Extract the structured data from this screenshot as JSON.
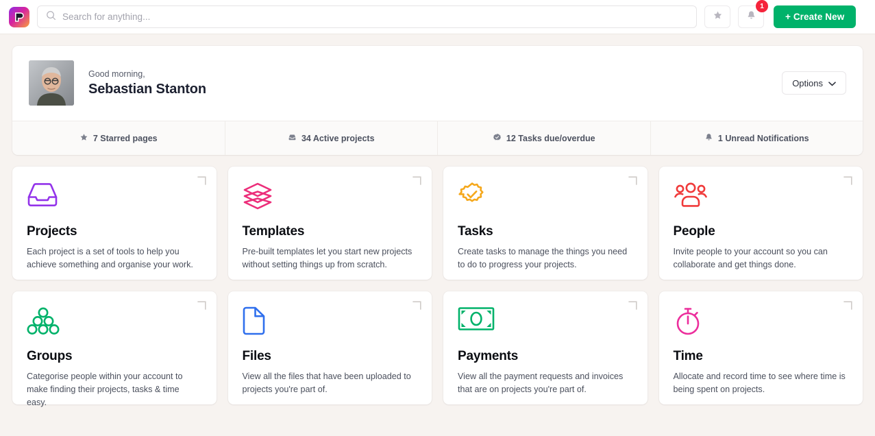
{
  "topbar": {
    "logo_icon": "flow-p-logo-icon",
    "search": {
      "icon": "search-icon",
      "placeholder": "Search for anything...",
      "value": ""
    },
    "star_button_icon": "star-icon",
    "notifications_button_icon": "bell-icon",
    "notifications_badge": "1",
    "create_label": "+ Create New"
  },
  "greeting": {
    "avatar_alt": "avatar",
    "salutation": "Good morning,",
    "name": "Sebastian Stanton",
    "options_label": "Options",
    "options_chevron_icon": "chevron-down-icon"
  },
  "stats": [
    {
      "icon": "star-icon",
      "label": "7 Starred pages"
    },
    {
      "icon": "inbox-icon",
      "label": "34 Active projects"
    },
    {
      "icon": "badge-check-icon",
      "label": "12 Tasks due/overdue"
    },
    {
      "icon": "bell-icon",
      "label": "1 Unread Notifications"
    }
  ],
  "tiles": [
    {
      "icon": "inbox-tray-icon",
      "color": "#9333ea",
      "title": "Projects",
      "desc": "Each project is a set of tools to help you achieve something and organise your work.",
      "corner_icon": "corner-expand-icon"
    },
    {
      "icon": "layers-icon",
      "color": "#ec2e7a",
      "title": "Templates",
      "desc": "Pre-built templates let you start new projects without setting things up from scratch.",
      "corner_icon": "corner-expand-icon"
    },
    {
      "icon": "badge-check-icon",
      "color": "#f5a81c",
      "title": "Tasks",
      "desc": "Create tasks to manage the things you need to do to progress your projects.",
      "corner_icon": "corner-expand-icon"
    },
    {
      "icon": "people-group-icon",
      "color": "#f03a3a",
      "title": "People",
      "desc": "Invite people to your account so you can collaborate and get things done.",
      "corner_icon": "corner-expand-icon"
    },
    {
      "icon": "circles-pyramid-icon",
      "color": "#00b26a",
      "title": "Groups",
      "desc": "Categorise people within your account to make finding their projects, tasks & time easy.",
      "corner_icon": "corner-expand-icon"
    },
    {
      "icon": "document-icon",
      "color": "#2f6fed",
      "title": "Files",
      "desc": "View all the files that have been uploaded to projects you're part of.",
      "corner_icon": "corner-expand-icon"
    },
    {
      "icon": "banknote-icon",
      "color": "#00b26a",
      "title": "Payments",
      "desc": "View all the payment requests and invoices that are on projects you're part of.",
      "corner_icon": "corner-expand-icon"
    },
    {
      "icon": "stopwatch-icon",
      "color": "#ec2e9c",
      "title": "Time",
      "desc": "Allocate and record time to see where time is being spent on projects.",
      "corner_icon": "corner-expand-icon"
    }
  ],
  "colors": {
    "page_background": "#f7f3f0",
    "accent_green": "#00b26a",
    "badge_red": "#f5233b"
  }
}
